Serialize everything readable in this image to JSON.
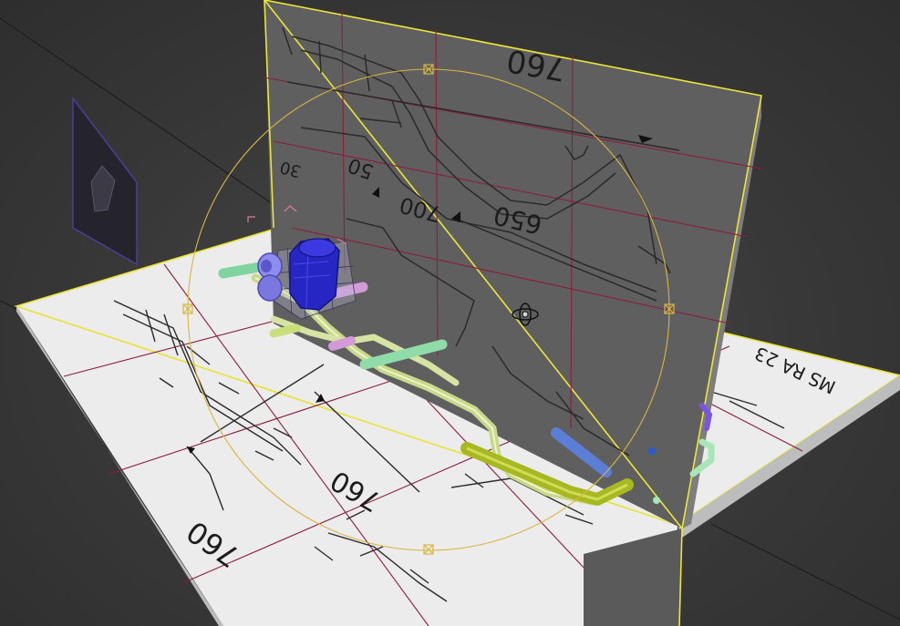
{
  "app": {
    "type": "3D modeling viewport",
    "view": "perspective",
    "active_tool": "rotate-gizmo"
  },
  "colors": {
    "viewport_bg": "#3a3a3a",
    "selection_highlight": "#e6e23a",
    "gizmo_ring": "#d8b640",
    "grid_lines": "#8a1e3c",
    "floor_plane": "#e6e6e6",
    "wall_plane": "#606060",
    "frame_tube": "#c9d98c",
    "rail_tube": "#9cd08f",
    "engine_block": "#2a2ac8",
    "engine_parts": "#7a78e0",
    "front_bar": "#a8b820",
    "blue_bar": "#5b7fd6",
    "pink_parts": "#d29ad6"
  },
  "blueprint_labels": {
    "wall_top_dim": "760",
    "wall_mid_dim": "700",
    "wall_small_dim": "50",
    "wall_side_dim": "30",
    "wall_lower_dim": "650",
    "floor_dim_1": "760",
    "floor_dim_2": "760",
    "floor_part_code": "MS RA 23"
  },
  "icons": {
    "pivot": "pivot-rotate-icon",
    "gizmo_handle": "gizmo-handle-icon"
  }
}
